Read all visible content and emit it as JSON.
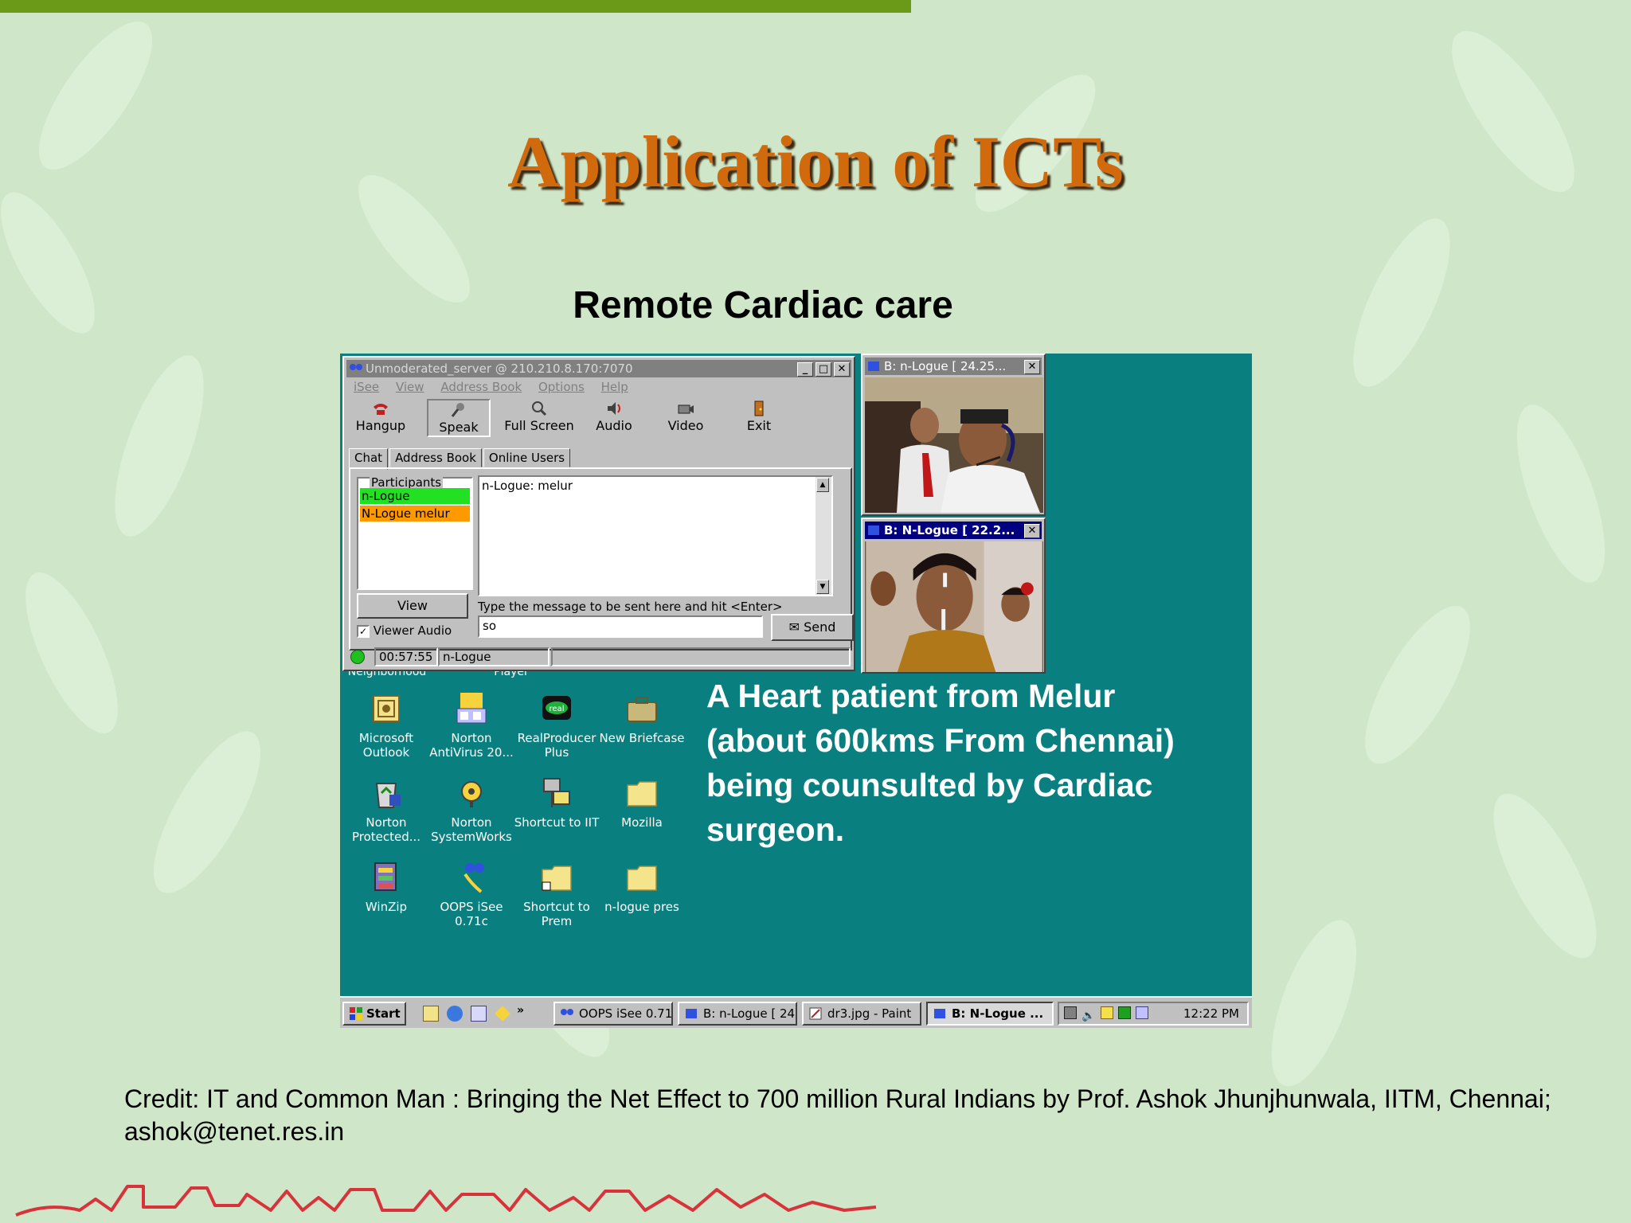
{
  "slide": {
    "title": "Application of ICTs",
    "subtitle": "Remote Cardiac care",
    "overlay_text": "A Heart patient from Melur (about 600kms From Chennai) being counsulted by Cardiac surgeon.",
    "credit": "Credit: IT and Common Man : Bringing the Net Effect to 700 million Rural Indians by Prof. Ashok Jhunjhunwala, IITM, Chennai; ashok@tenet.res.in",
    "colors": {
      "background": "#cfe6c9",
      "top_bar": "#6a9a17",
      "title": "#d06a0c",
      "desktop": "#0a7f80",
      "footer_art": "#d8323a"
    }
  },
  "app_window": {
    "title": "Unmoderated_server @ 210.210.8.170:7070",
    "menu": [
      "iSee",
      "View",
      "Address Book",
      "Options",
      "Help"
    ],
    "toolbar": [
      {
        "label": "Hangup",
        "icon": "phone-icon"
      },
      {
        "label": "Speak",
        "icon": "microphone-icon"
      },
      {
        "label": "Full Screen",
        "icon": "magnifier-icon"
      },
      {
        "label": "Audio",
        "icon": "speaker-icon"
      },
      {
        "label": "Video",
        "icon": "camera-icon"
      },
      {
        "label": "Exit",
        "icon": "door-icon"
      }
    ],
    "tabs": [
      "Chat",
      "Address Book",
      "Online Users"
    ],
    "active_tab": "Chat",
    "participants_label": "Participants",
    "participants": [
      {
        "name": "n-Logue",
        "color": "#22e022"
      },
      {
        "name": "N-Logue melur",
        "color": "#ff9900"
      }
    ],
    "chat_log": "n-Logue: melur",
    "view_button": "View",
    "viewer_audio_label": "Viewer Audio",
    "viewer_audio_checked": true,
    "message_hint": "Type the message to be sent here and hit <Enter>",
    "message_value": "so",
    "send_button": "Send",
    "status": {
      "time": "00:57:55",
      "user": "n-Logue"
    }
  },
  "video_windows": [
    {
      "title": "B: n-Logue [ 24.25..."
    },
    {
      "title": "B: N-Logue [ 22.2..."
    }
  ],
  "desktop": {
    "partial_labels": [
      "Neighborhood",
      "Player"
    ],
    "icons": [
      {
        "label": "Microsoft Outlook",
        "icon": "outlook-icon"
      },
      {
        "label": "Norton AntiVirus 20...",
        "icon": "norton-antivirus-icon"
      },
      {
        "label": "RealProducer Plus",
        "icon": "realproducer-icon"
      },
      {
        "label": "New Briefcase",
        "icon": "briefcase-icon"
      },
      {
        "label": "Norton Protected...",
        "icon": "recycle-bin-icon"
      },
      {
        "label": "Norton SystemWorks",
        "icon": "systemworks-icon"
      },
      {
        "label": "Shortcut to IIT",
        "icon": "network-computer-icon"
      },
      {
        "label": "Mozilla",
        "icon": "folder-icon"
      },
      {
        "label": "WinZip",
        "icon": "winzip-icon"
      },
      {
        "label": "OOPS iSee 0.71c",
        "icon": "isee-icon"
      },
      {
        "label": "Shortcut to Prem",
        "icon": "folder-icon"
      },
      {
        "label": "n-logue pres",
        "icon": "folder-icon"
      }
    ]
  },
  "taskbar": {
    "start": "Start",
    "items": [
      "OOPS iSee 0.71",
      "B: n-Logue [ 24...",
      "dr3.jpg - Paint",
      "B: N-Logue ..."
    ],
    "active_item": "B: N-Logue ...",
    "clock": "12:22 PM"
  }
}
